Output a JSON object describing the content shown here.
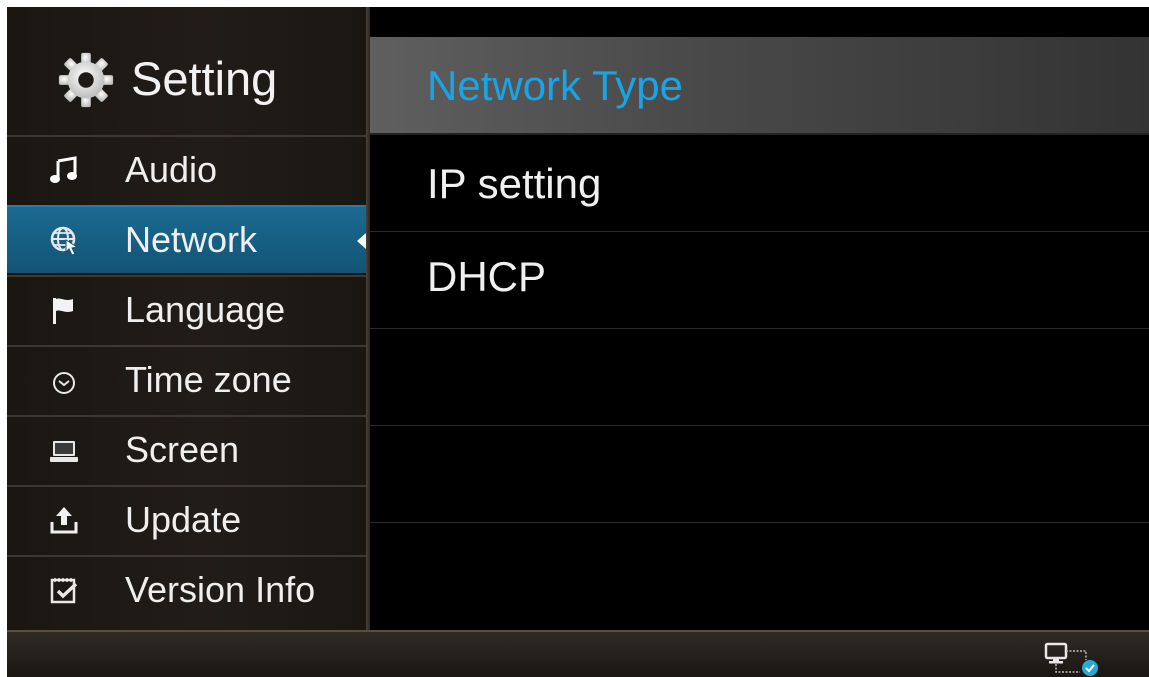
{
  "sidebar": {
    "title": "Setting",
    "title_icon": "gear-icon",
    "items": [
      {
        "label": "Audio",
        "icon": "music-note-icon",
        "active": false
      },
      {
        "label": "Network",
        "icon": "globe-network-icon",
        "active": true
      },
      {
        "label": "Language",
        "icon": "flag-icon",
        "active": false
      },
      {
        "label": "Time zone",
        "icon": "clock-icon",
        "active": false
      },
      {
        "label": "Screen",
        "icon": "laptop-screen-icon",
        "active": false
      },
      {
        "label": "Update",
        "icon": "upload-icon",
        "active": false
      },
      {
        "label": "Version Info",
        "icon": "document-check-icon",
        "active": false
      }
    ]
  },
  "content": {
    "rows": [
      {
        "label": "Network Type",
        "highlighted": true
      },
      {
        "label": "IP setting",
        "highlighted": false
      },
      {
        "label": "DHCP",
        "highlighted": false
      },
      {
        "label": "",
        "highlighted": false
      },
      {
        "label": "",
        "highlighted": false
      },
      {
        "label": "",
        "highlighted": false
      }
    ]
  },
  "statusbar": {
    "icon": "network-connected-icon"
  },
  "colors": {
    "accent_blue": "#1aa4e8",
    "active_item_bg": "#1b6a92",
    "status_ok": "#27a9d6"
  }
}
